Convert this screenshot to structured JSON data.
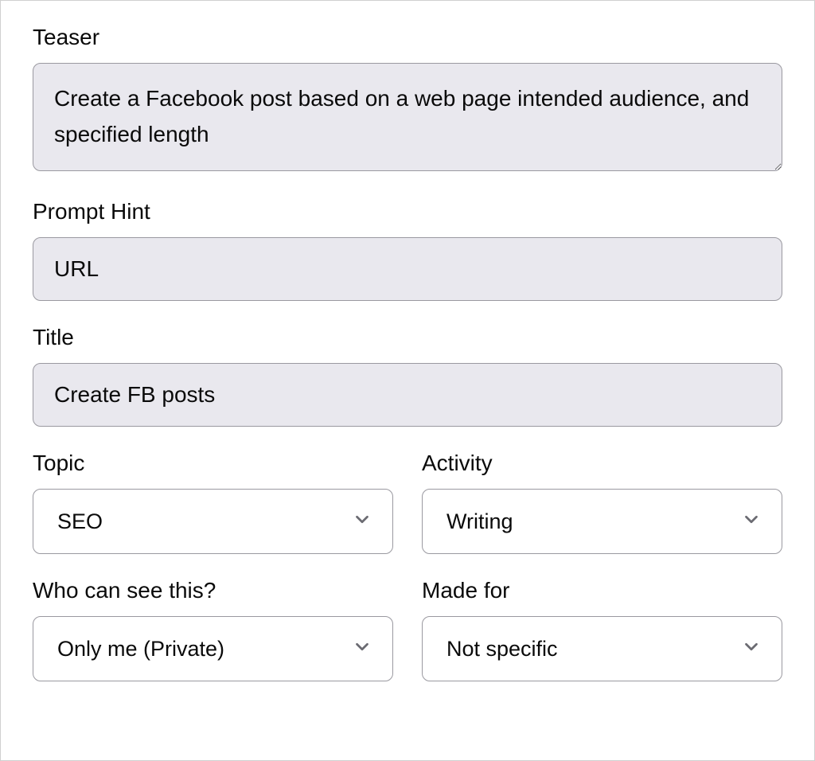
{
  "teaser": {
    "label": "Teaser",
    "value": "Create a Facebook post based on a web page intended audience, and specified length"
  },
  "promptHint": {
    "label": "Prompt Hint",
    "value": "URL"
  },
  "title": {
    "label": "Title",
    "value": "Create FB posts"
  },
  "topic": {
    "label": "Topic",
    "value": "SEO"
  },
  "activity": {
    "label": "Activity",
    "value": "Writing"
  },
  "visibility": {
    "label": "Who can see this?",
    "value": "Only me (Private)"
  },
  "madeFor": {
    "label": "Made for",
    "value": "Not specific"
  }
}
